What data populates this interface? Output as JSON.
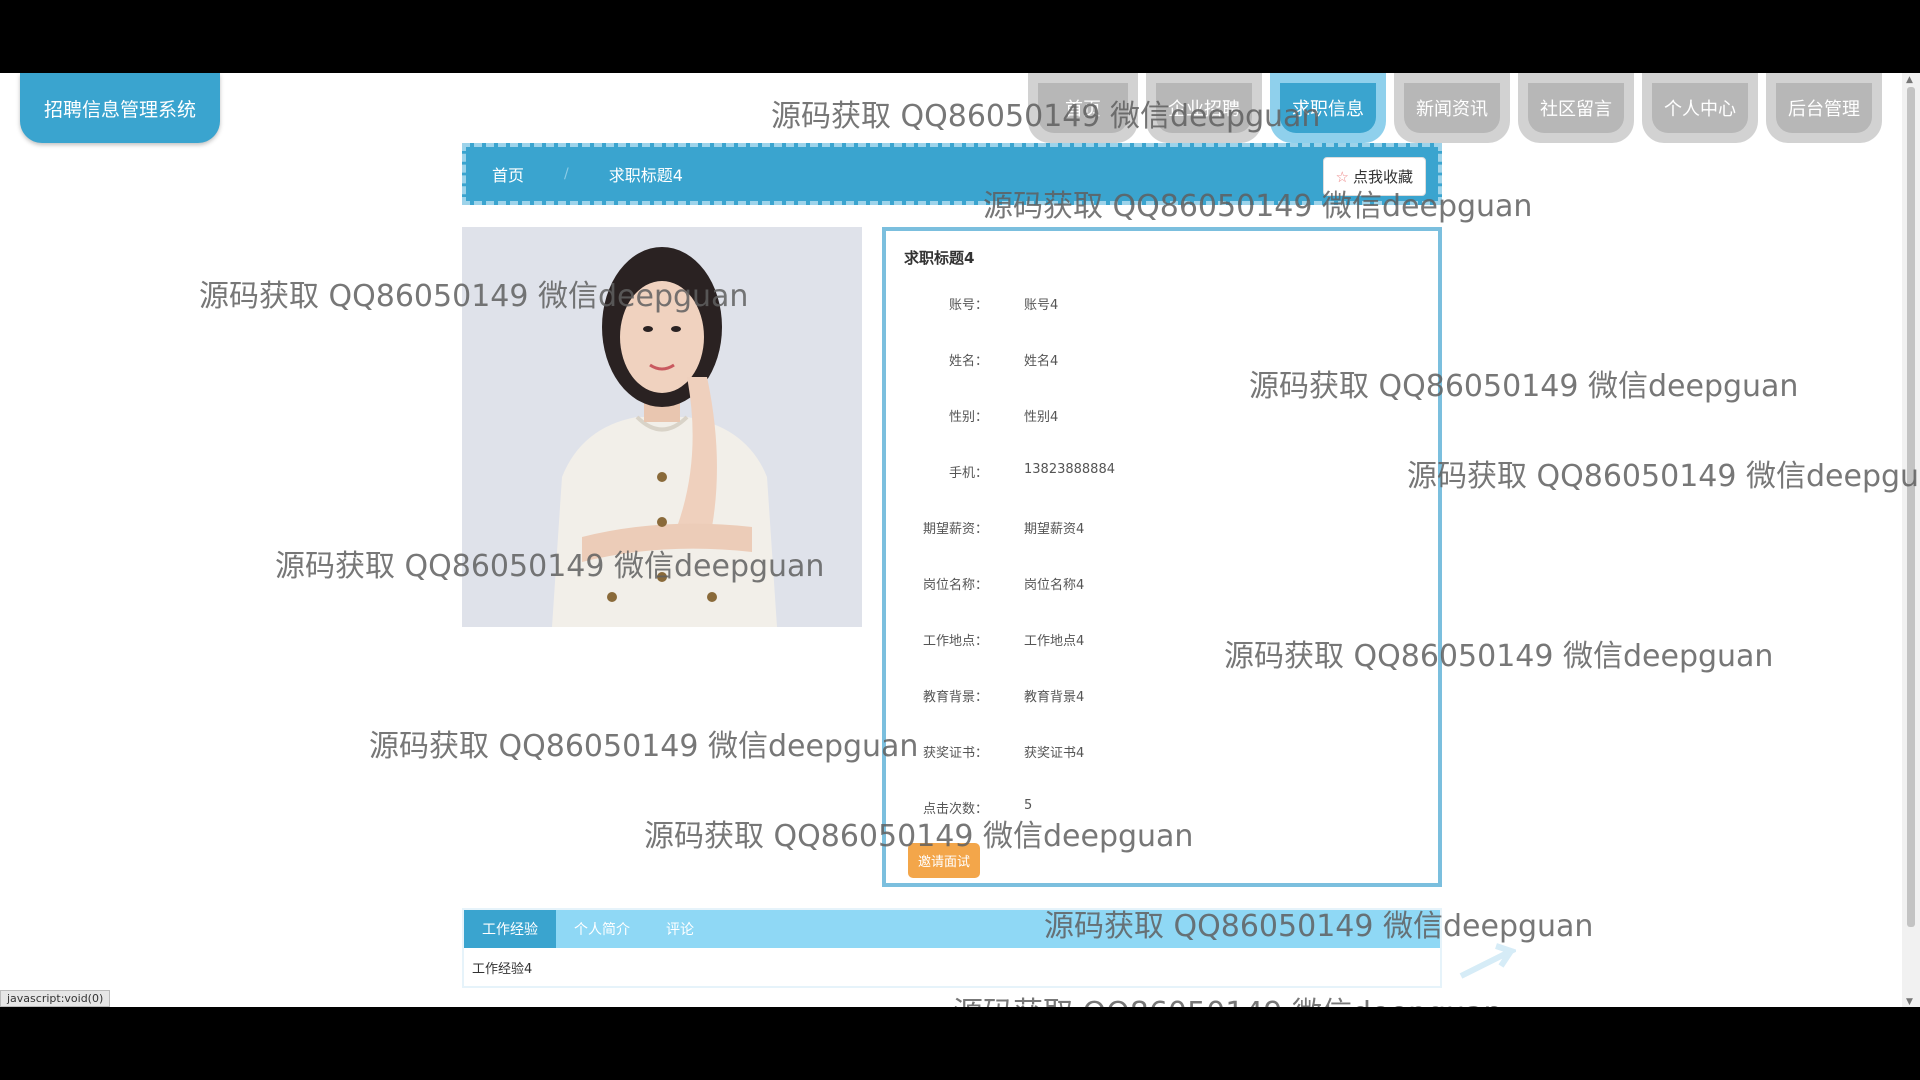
{
  "app": {
    "title": "招聘信息管理系统"
  },
  "nav": [
    "首页",
    "企业招聘",
    "求职信息",
    "新闻资讯",
    "社区留言",
    "个人中心",
    "后台管理"
  ],
  "breadcrumb": {
    "home": "首页",
    "sep": "/",
    "current": "求职标题4"
  },
  "favorite_label": "点我收藏",
  "detail": {
    "title": "求职标题4",
    "fields": [
      {
        "label": "账号：",
        "value": "账号4"
      },
      {
        "label": "姓名：",
        "value": "姓名4"
      },
      {
        "label": "性别：",
        "value": "性别4"
      },
      {
        "label": "手机：",
        "value": "13823888884"
      },
      {
        "label": "期望薪资：",
        "value": "期望薪资4"
      },
      {
        "label": "岗位名称：",
        "value": "岗位名称4"
      },
      {
        "label": "工作地点：",
        "value": "工作地点4"
      },
      {
        "label": "教育背景：",
        "value": "教育背景4"
      },
      {
        "label": "获奖证书：",
        "value": "获奖证书4"
      },
      {
        "label": "点击次数：",
        "value": "5"
      }
    ],
    "invite_label": "邀请面试"
  },
  "tabs": {
    "items": [
      "工作经验",
      "个人简介",
      "评论"
    ],
    "content": "工作经验4"
  },
  "status_bar": "javascript:void(0)",
  "watermark": "源码获取 QQ86050149 微信deepguan"
}
